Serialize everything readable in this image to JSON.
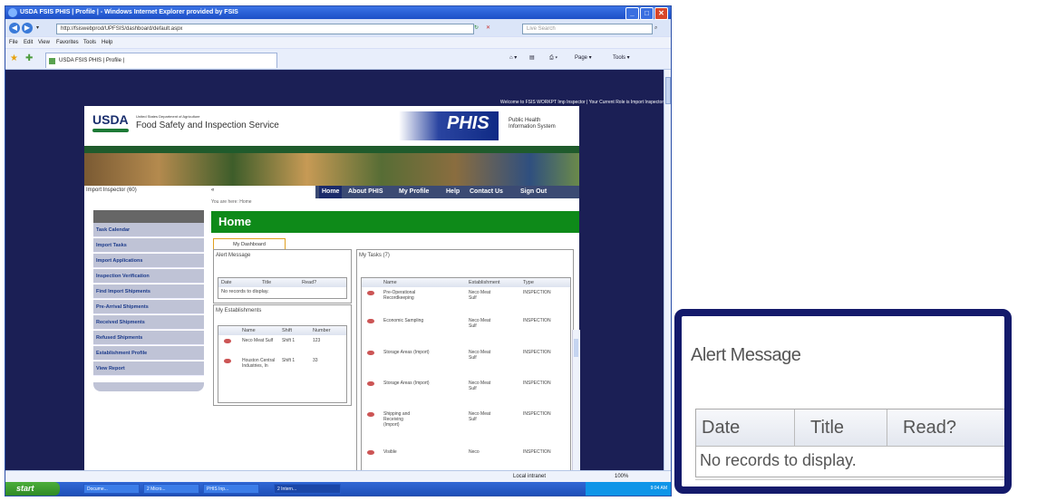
{
  "browser": {
    "title": "USDA FSIS PHIS | Profile | - Windows Internet Explorer provided by FSIS",
    "url": "http://fsiswebprod/UPFSIS/dashboard/default.aspx",
    "search_placeholder": "Live Search",
    "menu": [
      "File",
      "Edit",
      "View",
      "Favorites",
      "Tools",
      "Help"
    ],
    "tab_label": "USDA FSIS PHIS | Profile |",
    "toolbar": [
      "Page ▾",
      "Tools ▾"
    ],
    "status_zone": "Local intranet",
    "zoom": "100%"
  },
  "taskbar": {
    "start": "start",
    "items": [
      "Docume...",
      "2 Micro...",
      "PHIS Inp...",
      "2 Intern..."
    ],
    "clock": "9:04 AM"
  },
  "site": {
    "welcome": "Welcome to FSIS WORKPT Imp Inspector | Your Current Role is Import Inspector",
    "usda": "USDA",
    "dept": "United States Department of Agriculture",
    "agency": "Food Safety and Inspection Service",
    "phis_logo": "PHIS",
    "phis_name_1": "Public Health",
    "phis_name_2": "Information System",
    "importer": "Import Inspector (60)",
    "nav": [
      "Home",
      "About PHIS",
      "My Profile",
      "Help",
      "Contact Us",
      "Sign Out"
    ],
    "breadcrumb": "You are here: Home",
    "home_title": "Home",
    "dash_tab": "My Dashboard"
  },
  "sidebar": {
    "items": [
      "Task Calendar",
      "Import Tasks",
      "Import Applications",
      "Inspection Verification",
      "Find Import Shipments",
      "Pre-Arrival Shipments",
      "Received Shipments",
      "Refused Shipments",
      "Establishment Profile",
      "View Report"
    ]
  },
  "alert": {
    "title": "Alert Message",
    "columns": [
      "Date",
      "Title",
      "Read?"
    ],
    "empty": "No records to display."
  },
  "establishments": {
    "title": "My Establishments",
    "columns": [
      "Name",
      "Shift",
      "Number"
    ],
    "rows": [
      {
        "name": "Neco Meat Sulf",
        "shift": "Shift 1",
        "number": "123"
      },
      {
        "name": "Houston Central Industries, In",
        "shift": "Shift 1",
        "number": "33"
      }
    ]
  },
  "tasks": {
    "title": "My Tasks (7)",
    "columns": [
      "Name",
      "Establishment",
      "Type"
    ],
    "rows": [
      {
        "name": "Pre-Operational Recordkeeping",
        "est": "Neco Meat Sulf",
        "type": "INSPECTION"
      },
      {
        "name": "Economic Sampling",
        "est": "Neco Meat Sulf",
        "type": "INSPECTION"
      },
      {
        "name": "Storage Areas (Import)",
        "est": "Neco Meat Sulf",
        "type": "INSPECTION"
      },
      {
        "name": "Storage Areas (Import)",
        "est": "Neco Meat Sulf",
        "type": "INSPECTION"
      },
      {
        "name": "Shipping and Receiving (Import)",
        "est": "Neco Meat Sulf",
        "type": "INSPECTION"
      },
      {
        "name": "Visible",
        "est": "Neco",
        "type": "INSPECTION"
      }
    ]
  },
  "zoom_panel": {
    "title": "Alert Message",
    "columns": [
      "Date",
      "Title",
      "Read?"
    ],
    "empty": "No records to display."
  }
}
